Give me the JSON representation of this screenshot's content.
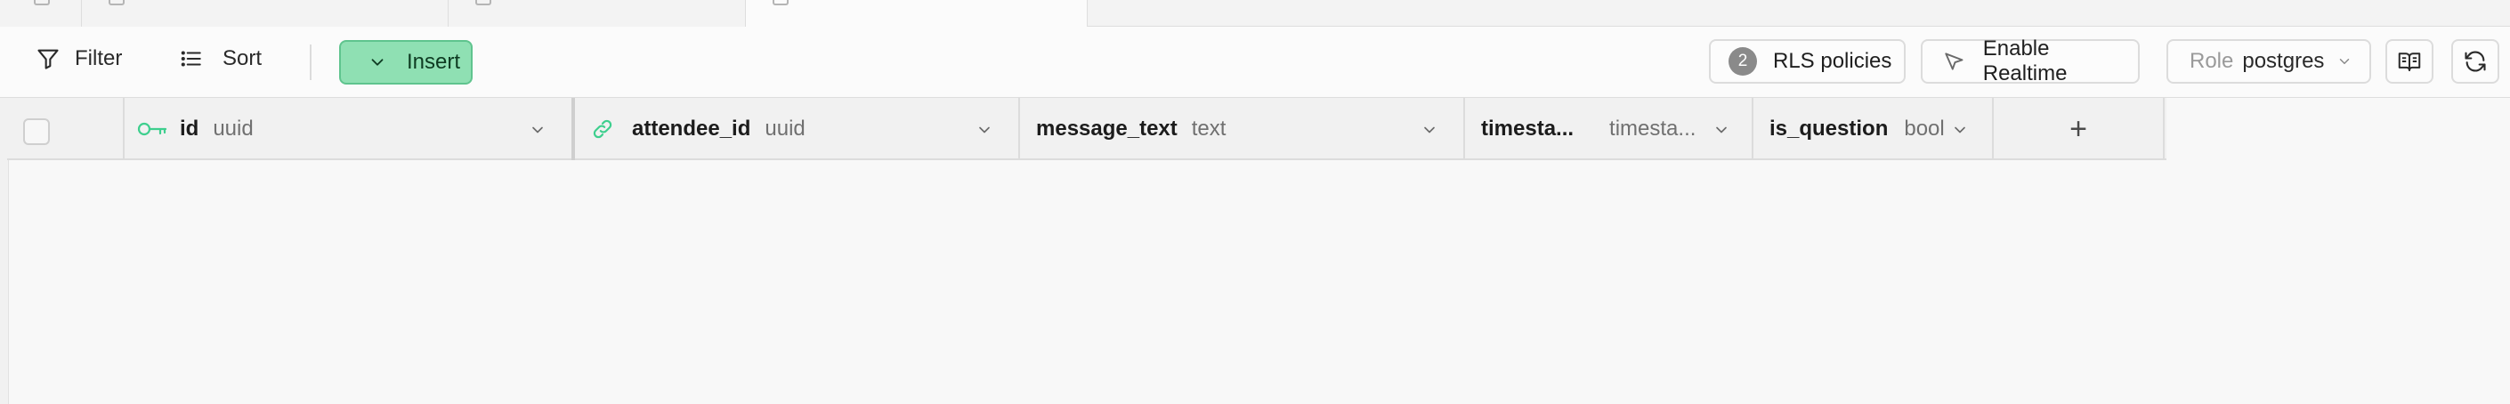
{
  "toolbar": {
    "filter_label": "Filter",
    "sort_label": "Sort",
    "insert_label": "Insert",
    "rls_count": "2",
    "rls_label": "RLS policies",
    "realtime_label": "Enable Realtime",
    "role_prefix": "Role",
    "role_value": "postgres"
  },
  "columns": [
    {
      "name": "id",
      "type": "uuid",
      "icon": "key-icon"
    },
    {
      "name": "attendee_id",
      "type": "uuid",
      "icon": "link-icon"
    },
    {
      "name": "message_text",
      "type": "text"
    },
    {
      "name": "timesta...",
      "type": "timesta..."
    },
    {
      "name": "is_question",
      "type": "bool"
    }
  ],
  "add_column_label": "+",
  "colors": {
    "insert_bg": "#8fe0b3",
    "insert_border": "#5fc48e",
    "key_icon": "#3ecf8e",
    "link_icon": "#3ecf8e"
  }
}
